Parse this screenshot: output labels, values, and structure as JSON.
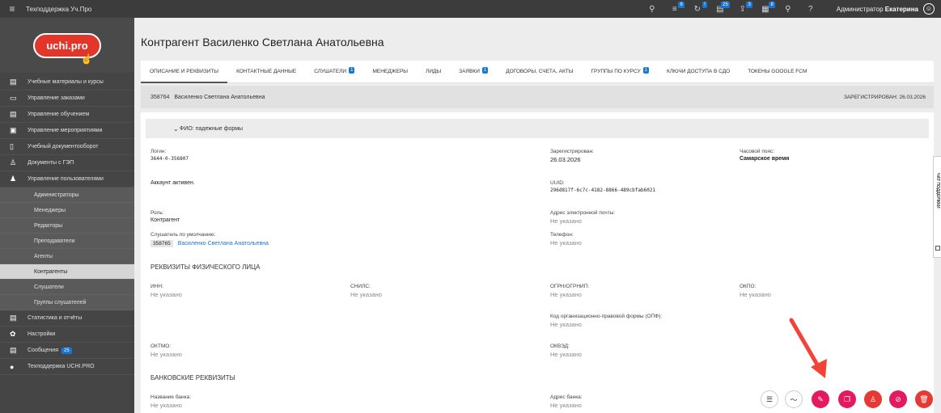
{
  "topbar": {
    "title": "Техподдержка Уч.Про",
    "icons": [
      {
        "name": "org-icon",
        "glyph": "⚲",
        "badge": ""
      },
      {
        "name": "list-icon",
        "glyph": "≡",
        "badge": "6"
      },
      {
        "name": "refresh-icon",
        "glyph": "↻",
        "badge": "!"
      },
      {
        "name": "chat-icon",
        "glyph": "▤",
        "badge": "25"
      },
      {
        "name": "export-icon",
        "glyph": "⇪",
        "badge": "3"
      },
      {
        "name": "report-icon",
        "glyph": "▦",
        "badge": "8"
      },
      {
        "name": "pin-icon",
        "glyph": "⚲",
        "badge": ""
      },
      {
        "name": "help-icon",
        "glyph": "?",
        "badge": ""
      }
    ],
    "user_prefix": "Администратор",
    "user_name": "Екатерина"
  },
  "sidebar": {
    "logo": "uchi.pro",
    "items": [
      {
        "label": "Учебные материалы и курсы",
        "icon": "▤"
      },
      {
        "label": "Управление заказами",
        "icon": "▭"
      },
      {
        "label": "Управление обучением",
        "icon": "▤"
      },
      {
        "label": "Управление мероприятиями",
        "icon": "▣"
      },
      {
        "label": "Учебный документооборот",
        "icon": "▯"
      },
      {
        "label": "Документы с ГЭП",
        "icon": "♙"
      },
      {
        "label": "Управление пользователями",
        "icon": "♟"
      }
    ],
    "subitems": [
      "Администраторы",
      "Менеджеры",
      "Редакторы",
      "Преподаватели",
      "Агенты",
      "Контрагенты",
      "Слушатели",
      "Группы слушателей"
    ],
    "bottom_items": [
      {
        "label": "Статистика и отчёты",
        "icon": "▤",
        "count": ""
      },
      {
        "label": "Настройки",
        "icon": "✿",
        "count": ""
      },
      {
        "label": "Сообщения",
        "icon": "▤",
        "count": "25"
      },
      {
        "label": "Техподдержка UCHI.PRO",
        "icon": "●",
        "count": ""
      }
    ]
  },
  "page": {
    "title": "Контрагент Василенко Светлана Анатольевна",
    "tabs": [
      {
        "label": "ОПИСАНИЕ И РЕКВИЗИТЫ",
        "badge": ""
      },
      {
        "label": "КОНТАКТНЫЕ ДАННЫЕ",
        "badge": ""
      },
      {
        "label": "СЛУШАТЕЛИ",
        "badge": "1"
      },
      {
        "label": "МЕНЕДЖЕРЫ",
        "badge": ""
      },
      {
        "label": "ЛИДЫ",
        "badge": ""
      },
      {
        "label": "ЗАЯВКИ",
        "badge": "1"
      },
      {
        "label": "ДОГОВОРЫ, СЧЕТА, АКТЫ",
        "badge": ""
      },
      {
        "label": "ГРУППЫ ПО КУРСУ",
        "badge": "1"
      },
      {
        "label": "КЛЮЧИ ДОСТУПА В СДО",
        "badge": ""
      },
      {
        "label": "ТОКЕНЫ GOOGLE FCM",
        "badge": ""
      }
    ],
    "info": {
      "id": "358764",
      "name": "Василенко Светлана Анатольевна",
      "registered": "ЗАРЕГИСТРИРОВАН: 26.03.2026"
    },
    "fio_section": "ФИО: падежные формы",
    "fields": {
      "login_label": "Логин:",
      "login_value": "3644-0-356807",
      "registered_label": "Зарегистрирован:",
      "registered_value": "26.03.2026",
      "tz_label": "Часовой пояс:",
      "tz_value": "Самарское время",
      "account_status": "Аккаунт активен.",
      "uuid_label": "UUID:",
      "uuid_value": "296d817f-6c7c-4182-8866-489cbfab6021",
      "role_label": "Роль:",
      "role_value": "Контрагент",
      "email_label": "Адрес электронной почты:",
      "email_value": "Не указано",
      "listener_label": "Слушатель по умолчанию:",
      "listener_id": "358765",
      "listener_name": "Василенко Светлана Анатольевна",
      "phone_label": "Телефон:",
      "phone_value": "Не указано"
    },
    "physical_section": "РЕКВИЗИТЫ ФИЗИЧЕСКОГО ЛИЦА",
    "physical": {
      "inn_label": "ИНН:",
      "inn_value": "Не указано",
      "snils_label": "СНИЛС:",
      "snils_value": "Не указано",
      "ogrn_label": "ОГРН/ОГРНИП:",
      "ogrn_value": "Не указано",
      "okpo_label": "ОКПО:",
      "okpo_value": "Не указано",
      "opf_label": "Код организационно-правовой формы (ОПФ):",
      "opf_value": "Не указано",
      "oktmo_label": "ОКТМО:",
      "oktmo_value": "Не указано",
      "okved_label": "ОКВЭД:",
      "okved_value": "Не указано"
    },
    "bank_section": "БАНКОВСКИЕ РЕКВИЗИТЫ",
    "bank": {
      "bank_name_label": "Название банка:",
      "bank_name_value": "Не указано",
      "bank_addr_label": "Адрес банка:",
      "bank_addr_value": "Не указано"
    },
    "side_tab": "ЧАТ ПОДДЕРЖКИ"
  },
  "actions": [
    {
      "name": "menu-list-button",
      "icon": "list-icon",
      "glyph": "☰",
      "style": "light"
    },
    {
      "name": "stats-button",
      "icon": "trend-icon",
      "glyph": "〜",
      "style": "light"
    },
    {
      "name": "edit-button",
      "icon": "pencil-icon",
      "glyph": "✎",
      "style": "pink"
    },
    {
      "name": "copy-button",
      "icon": "copy-icon",
      "glyph": "❐",
      "style": "pink"
    },
    {
      "name": "login-as-button",
      "icon": "person-icon",
      "glyph": "♙",
      "style": "red"
    },
    {
      "name": "hide-button",
      "icon": "eye-off-icon",
      "glyph": "⊘",
      "style": "pink"
    },
    {
      "name": "delete-button",
      "icon": "trash-icon",
      "glyph": "🗑",
      "style": "red"
    }
  ],
  "colors": {
    "accent": "#1976d2",
    "pink": "#e5195f",
    "red": "#e53935",
    "arrow": "#f44336"
  }
}
